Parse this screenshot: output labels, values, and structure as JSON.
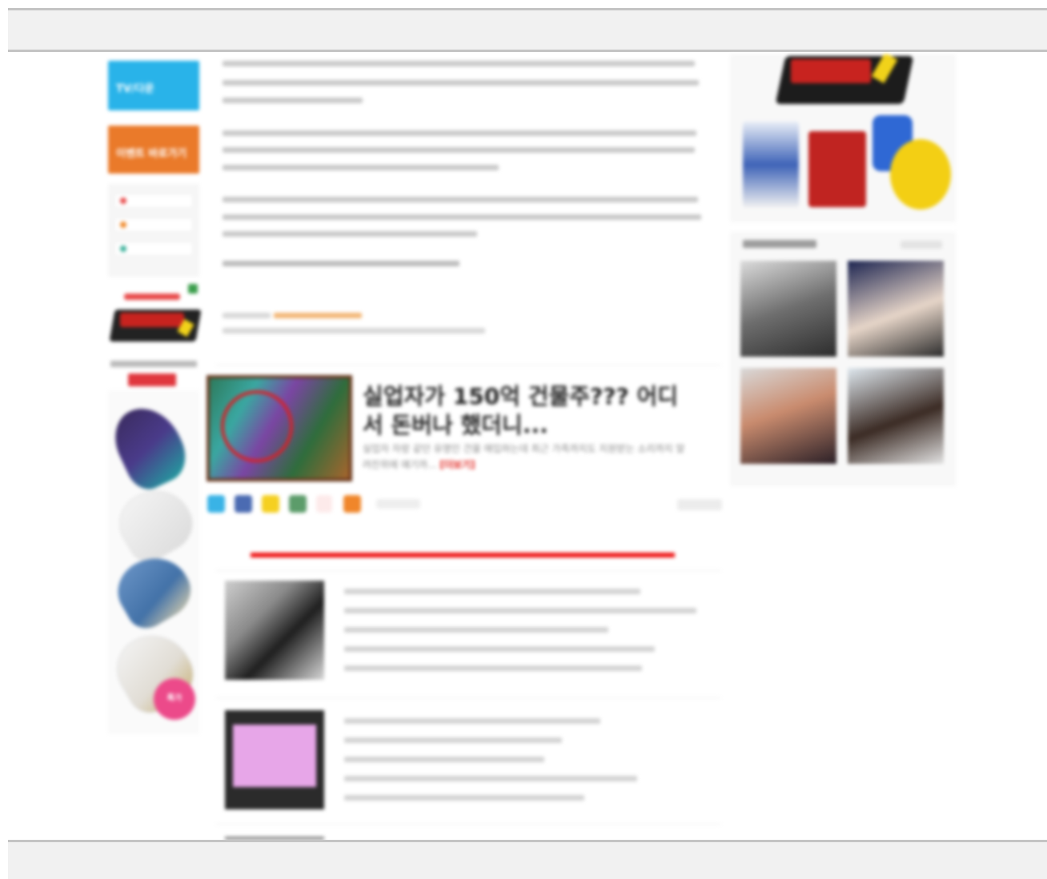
{
  "left_sidebar": {
    "blue_button": "TV/다운",
    "orange_button": "이벤트 바로가기",
    "shoe_badge": "특가"
  },
  "article": {
    "card_title": "실업자가 150억 건물주??? 어디서 돈버나 했더니...",
    "card_desc": "실업자 자랑 같던 유명인 건물 매입하는데 최근 가족까지도 지원받는 소리까지 알려진위에 얘기까...",
    "card_more": "[더보기]"
  },
  "colors": {
    "accent_red": "#ee1111",
    "blue_button": "#29b3e9",
    "orange_button": "#ea7a2a"
  }
}
